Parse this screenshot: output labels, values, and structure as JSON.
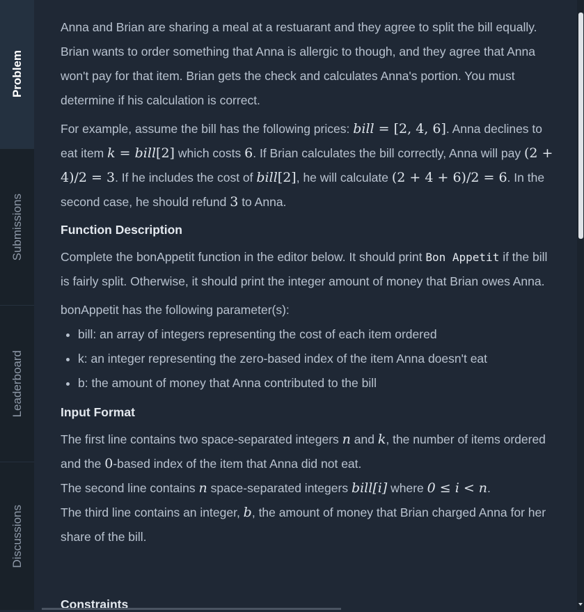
{
  "sidebar": {
    "tabs": [
      {
        "label": "Problem"
      },
      {
        "label": "Submissions"
      },
      {
        "label": "Leaderboard"
      },
      {
        "label": "Discussions"
      }
    ]
  },
  "problem": {
    "intro": "Anna and Brian are sharing a meal at a restuarant and they agree to split the bill equally. Brian wants to order something that Anna is allergic to though, and they agree that Anna won't pay for that item. Brian gets the check and calculates Anna's portion. You must determine if his calculation is correct.",
    "ex_a": "For example, assume the bill has the following prices: ",
    "ex_bill": "bill",
    "ex_eq1": " = [2, 4, 6]",
    "ex_b": ". Anna declines to eat item ",
    "ex_k": "k",
    "ex_eq2": " = ",
    "ex_bill2": "bill",
    "ex_idx2": "[2]",
    "ex_c": " which costs ",
    "ex_6": "6",
    "ex_d": ". If Brian calculates the bill correctly, Anna will pay ",
    "ex_calc1": "(2 + 4)/2 = 3",
    "ex_e": ". If he includes the cost of ",
    "ex_bill3": "bill",
    "ex_idx3": "[2]",
    "ex_f": ", he will calculate ",
    "ex_calc2": "(2 + 4 + 6)/2 = 6",
    "ex_g": ". In the second case, he should refund ",
    "ex_3": "3",
    "ex_h": " to Anna.",
    "func_heading": "Function Description",
    "func_a": "Complete the bonAppetit function in the editor below. It should print ",
    "func_code": "Bon Appetit",
    "func_b": " if the bill is fairly split. Otherwise, it should print the integer amount of money that Brian owes Anna.",
    "params_intro": "bonAppetit has the following parameter(s):",
    "params": [
      "bill: an array of integers representing the cost of each item ordered",
      "k: an integer representing the zero-based index of the item Anna doesn't eat",
      "b: the amount of money that Anna contributed to the bill"
    ],
    "input_heading": "Input Format",
    "in1_a": "The first line contains two space-separated integers ",
    "in1_n": "n",
    "in1_b": " and ",
    "in1_k": "k",
    "in1_c": ", the number of items ordered and the ",
    "in1_0": "0",
    "in1_d": "-based index of the item that Anna did not eat.",
    "in2_a": "The second line contains ",
    "in2_n": "n",
    "in2_b": " space-separated integers ",
    "in2_bill": "bill[i]",
    "in2_c": " where ",
    "in2_rng": "0 ≤ i < n",
    "in2_d": ".",
    "in3_a": "The third line contains an integer, ",
    "in3_b": "b",
    "in3_c": ", the amount of money that Brian charged Anna for her share of the bill.",
    "constraints_heading": "Constraints"
  }
}
